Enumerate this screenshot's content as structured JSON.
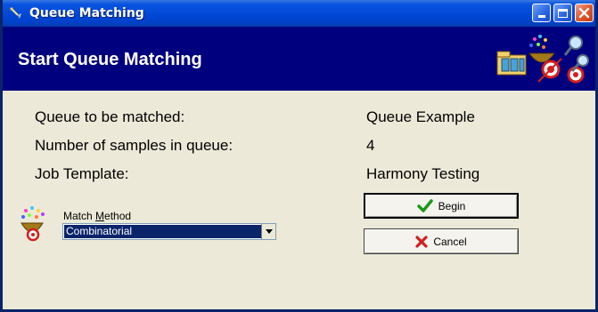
{
  "window": {
    "title": "Queue Matching"
  },
  "header": {
    "title": "Start Queue Matching"
  },
  "info": {
    "queue_label": "Queue to be matched:",
    "queue_value": "Queue Example",
    "samples_label": "Number of samples in queue:",
    "samples_value": "4",
    "template_label": "Job Template:",
    "template_value": "Harmony Testing"
  },
  "match_method": {
    "label_prefix": "Match ",
    "label_underlined": "M",
    "label_rest": "ethod",
    "selected": "Combinatorial"
  },
  "buttons": {
    "begin": "Begin",
    "cancel": "Cancel"
  },
  "colors": {
    "header_band": "#00007f",
    "title_bar": "#0046d5",
    "selection": "#0a246a",
    "begin_check": "#1a9a1a",
    "cancel_x": "#d21f1f"
  }
}
